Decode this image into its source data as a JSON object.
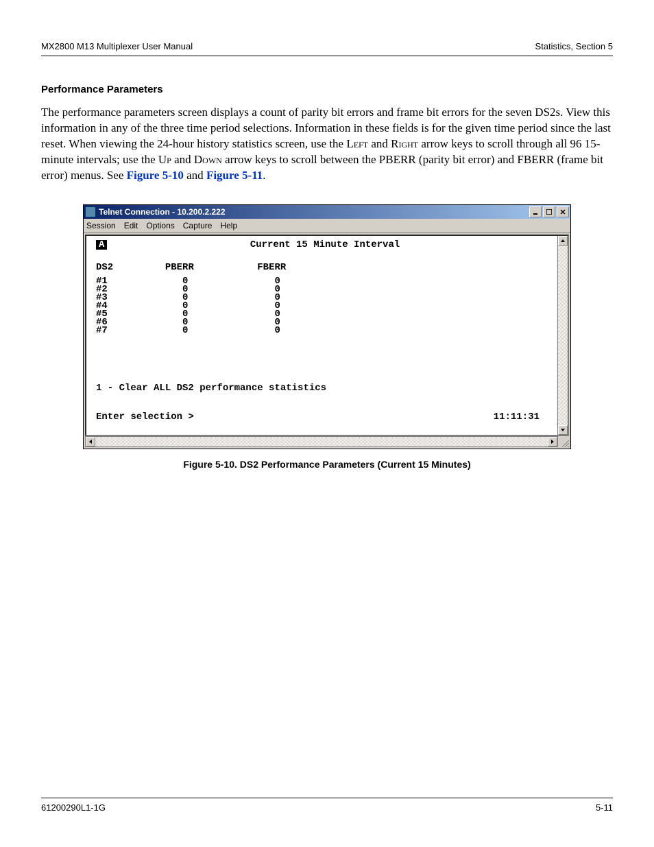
{
  "header": {
    "left": "MX2800 M13 Multiplexer User Manual",
    "right": "Statistics, Section 5"
  },
  "section": {
    "heading": "Performance Parameters",
    "body_prefix": "The performance parameters screen displays a count of parity bit errors and frame bit errors for the seven DS2s. View this information in any of the three time period selections. Information in these fields is for the given time period since the last reset. When viewing the 24-hour history statistics screen, use the ",
    "key_left": "Left",
    "body_mid1": " and ",
    "key_right": "Right",
    "body_mid2": " arrow keys to scroll through all 96 15-minute intervals; use the ",
    "key_up": "Up",
    "body_mid3": " and ",
    "key_down": "Down",
    "body_mid4": " arrow keys to scroll between the PBERR (parity bit error) and FBERR (frame bit error) menus. See ",
    "link1": "Figure 5-10",
    "body_mid5": " and ",
    "link2": "Figure 5-11",
    "body_end": "."
  },
  "window": {
    "title": "Telnet Connection - 10.200.2.222",
    "menus": [
      "Session",
      "Edit",
      "Options",
      "Capture",
      "Help"
    ],
    "terminal": {
      "cursor_label": "A",
      "interval_title": "Current 15 Minute Interval",
      "col_ds2": "DS2",
      "col_pberr": "PBERR",
      "col_fberr": "FBERR",
      "rows": [
        {
          "id": "#1",
          "pberr": "0",
          "fberr": "0"
        },
        {
          "id": "#2",
          "pberr": "0",
          "fberr": "0"
        },
        {
          "id": "#3",
          "pberr": "0",
          "fberr": "0"
        },
        {
          "id": "#4",
          "pberr": "0",
          "fberr": "0"
        },
        {
          "id": "#5",
          "pberr": "0",
          "fberr": "0"
        },
        {
          "id": "#6",
          "pberr": "0",
          "fberr": "0"
        },
        {
          "id": "#7",
          "pberr": "0",
          "fberr": "0"
        }
      ],
      "option_line": "1 - Clear ALL DS2 performance statistics",
      "prompt": "Enter selection >",
      "clock": "11:11:31"
    }
  },
  "figure_caption": "Figure 5-10.  DS2 Performance Parameters (Current 15 Minutes)",
  "footer": {
    "left": "61200290L1-1G",
    "right": "5-11"
  }
}
